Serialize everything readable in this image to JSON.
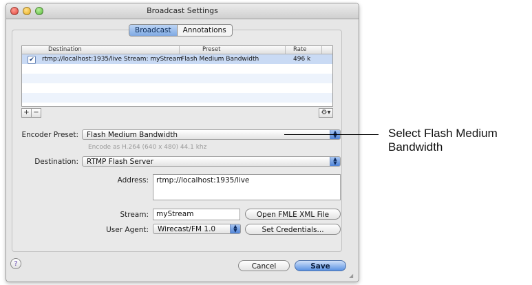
{
  "window": {
    "title": "Broadcast Settings"
  },
  "tabs": [
    {
      "label": "Broadcast",
      "selected": true
    },
    {
      "label": "Annotations",
      "selected": false
    }
  ],
  "table": {
    "headers": [
      "Destination",
      "Preset",
      "Rate"
    ],
    "rows": [
      {
        "checked": true,
        "destination": "rtmp://localhost:1935/live Stream: myStream",
        "preset": "Flash Medium Bandwidth",
        "rate": "496 k"
      }
    ]
  },
  "table_controls": {
    "add": "+",
    "remove": "−",
    "action": "⚙▾"
  },
  "encoder": {
    "label": "Encoder Preset:",
    "value": "Flash Medium Bandwidth",
    "hint": "Encode as H.264 (640 x 480) 44.1 khz"
  },
  "destination": {
    "label": "Destination:",
    "value": "RTMP Flash Server"
  },
  "address": {
    "label": "Address:",
    "value": "rtmp://localhost:1935/live"
  },
  "stream": {
    "label": "Stream:",
    "value": "myStream",
    "button": "Open FMLE XML File"
  },
  "user_agent": {
    "label": "User Agent:",
    "value": "Wirecast/FM 1.0",
    "button": "Set Credentials..."
  },
  "footer": {
    "help": "?",
    "cancel": "Cancel",
    "save": "Save"
  },
  "callout": {
    "text": "Select Flash Medium Bandwidth"
  },
  "colors": {
    "accent": "#5a92e3",
    "selection_row": "#c9daf4",
    "window_bg": "#e6e6e6"
  }
}
